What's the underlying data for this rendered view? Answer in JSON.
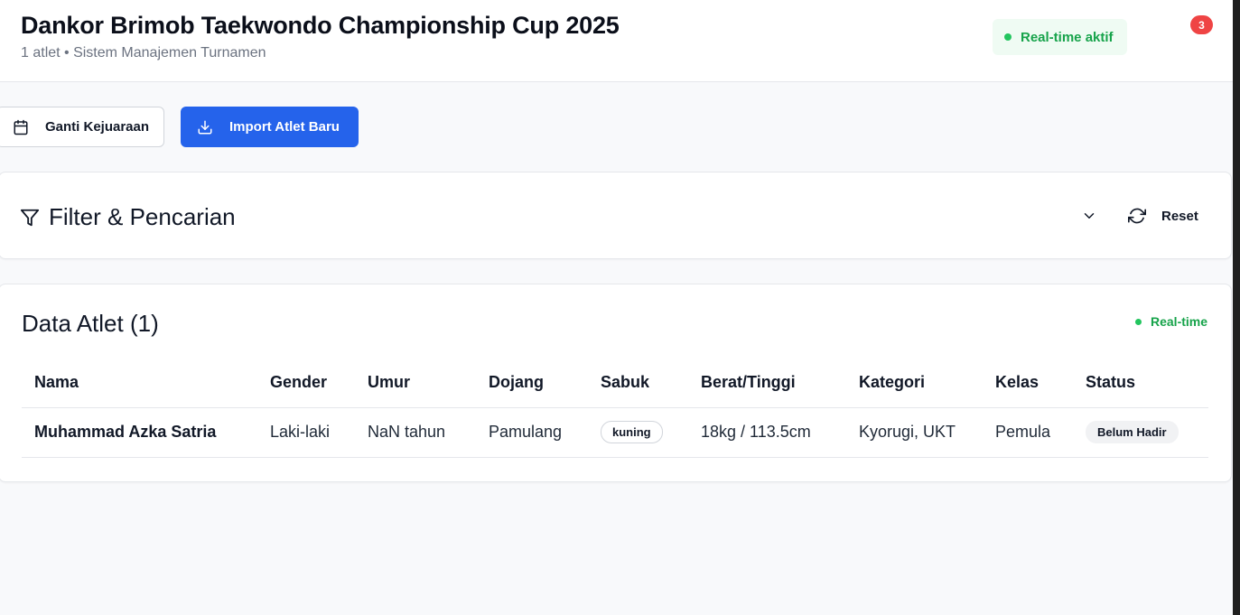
{
  "header": {
    "title": "Dankor Brimob Taekwondo Championship Cup 2025",
    "subtitle": "1 atlet • Sistem Manajemen Turnamen",
    "realtime_label": "Real-time aktif",
    "notification_count": "3"
  },
  "actions": {
    "change_tournament_label": "Ganti Kejuaraan",
    "import_label": "Import Atlet Baru"
  },
  "filter": {
    "title": "Filter & Pencarian",
    "reset_label": "Reset"
  },
  "athletes": {
    "title": "Data Atlet (1)",
    "realtime_label": "Real-time",
    "columns": [
      "Nama",
      "Gender",
      "Umur",
      "Dojang",
      "Sabuk",
      "Berat/Tinggi",
      "Kategori",
      "Kelas",
      "Status"
    ],
    "rows": [
      {
        "name": "Muhammad Azka Satria",
        "gender": "Laki-laki",
        "age": "NaN tahun",
        "dojang": "Pamulang",
        "belt": "kuning",
        "weight_height": "18kg / 113.5cm",
        "category": "Kyorugi, UKT",
        "class": "Pemula",
        "status": "Belum Hadir"
      }
    ]
  },
  "colors": {
    "primary": "#2563eb",
    "success": "#16a34a",
    "danger": "#ef4444"
  },
  "icons": [
    "calendar-icon",
    "download-icon",
    "filter-icon",
    "chevron-down-icon",
    "refresh-icon",
    "realtime-dot-icon"
  ]
}
